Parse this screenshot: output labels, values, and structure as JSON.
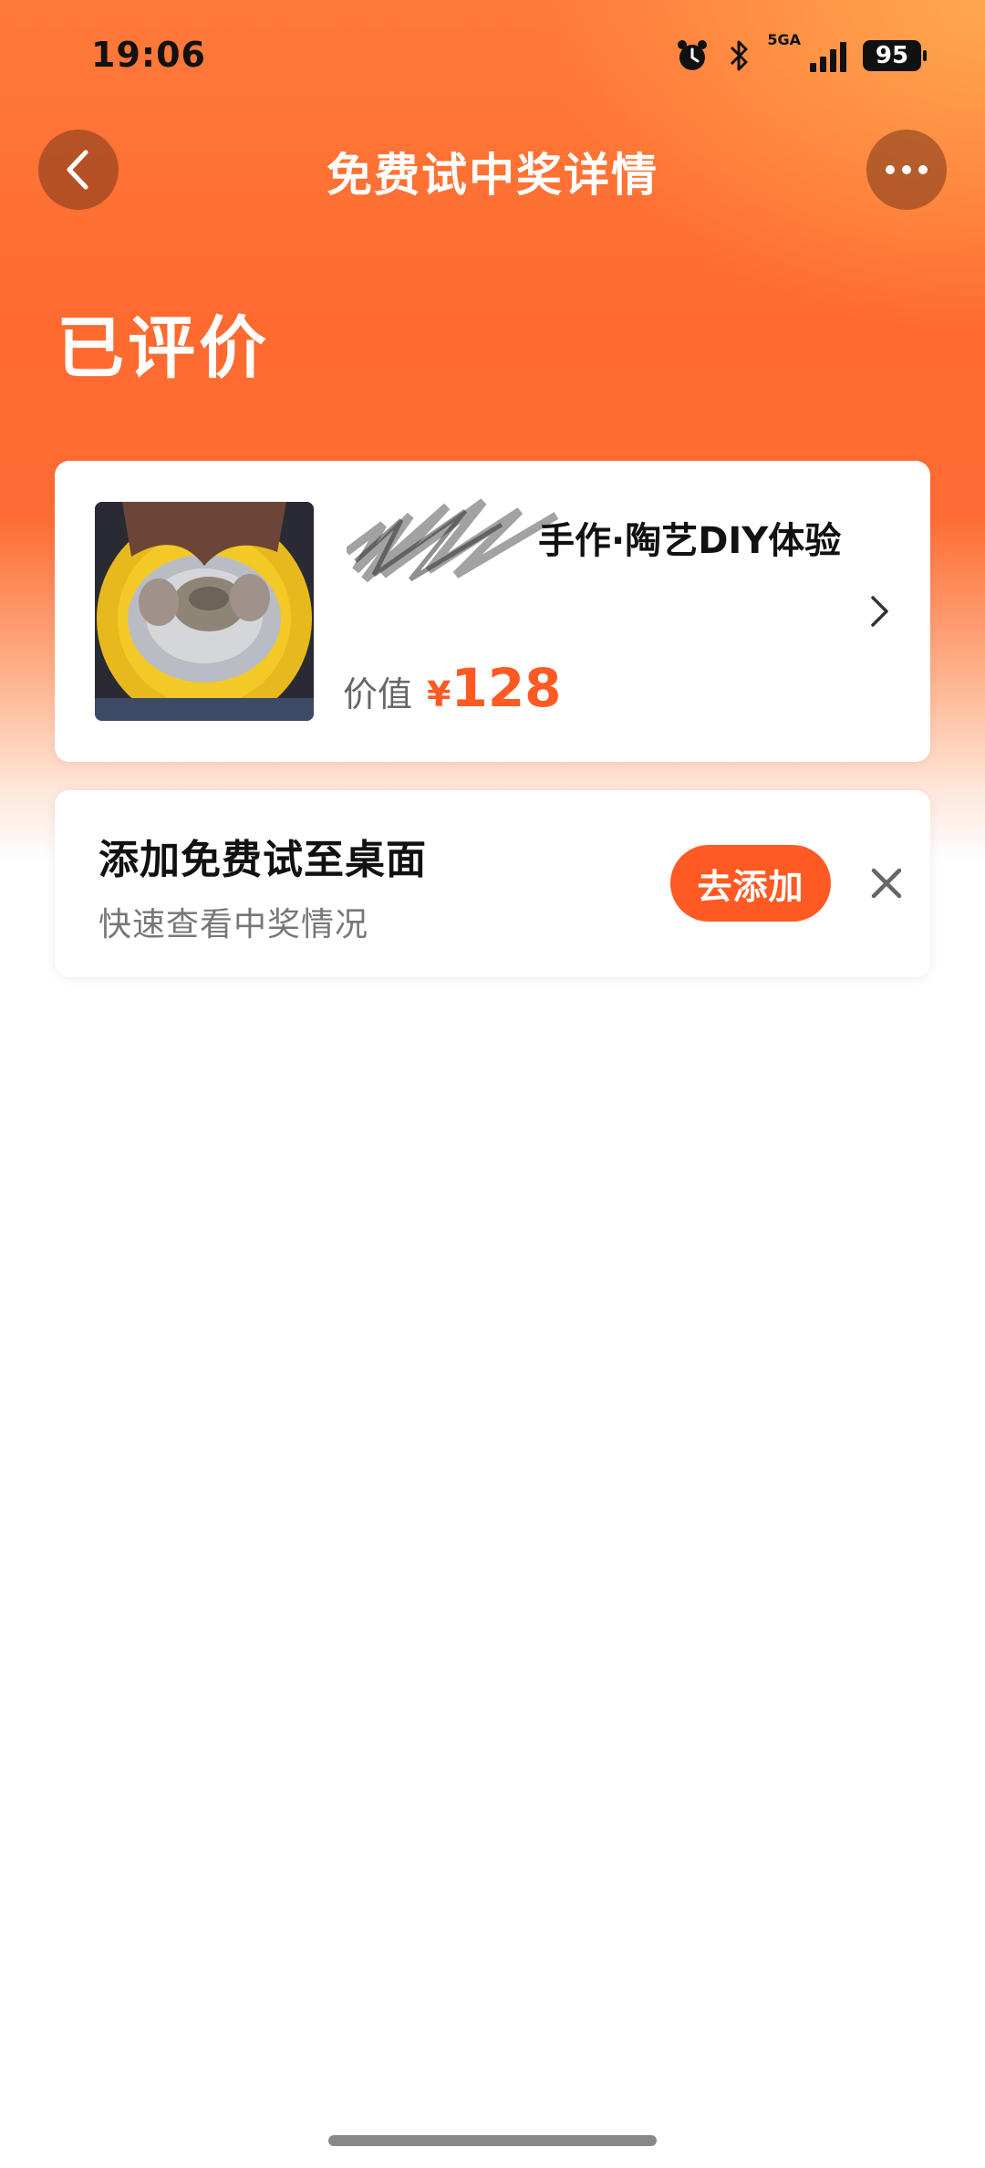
{
  "status_bar": {
    "time": "19:06",
    "network": "5GA",
    "battery": "95"
  },
  "nav": {
    "title": "免费试中奖详情"
  },
  "status_heading": "已评价",
  "product": {
    "name": "手作·陶艺DIY体验",
    "price_label": "价值",
    "price_currency": "¥",
    "price_value": "128"
  },
  "promo": {
    "title": "添加免费试至桌面",
    "subtitle": "快速查看中奖情况",
    "add_label": "去添加"
  },
  "colors": {
    "accent": "#ff5a23",
    "hero_top": "#ff7a3a"
  }
}
